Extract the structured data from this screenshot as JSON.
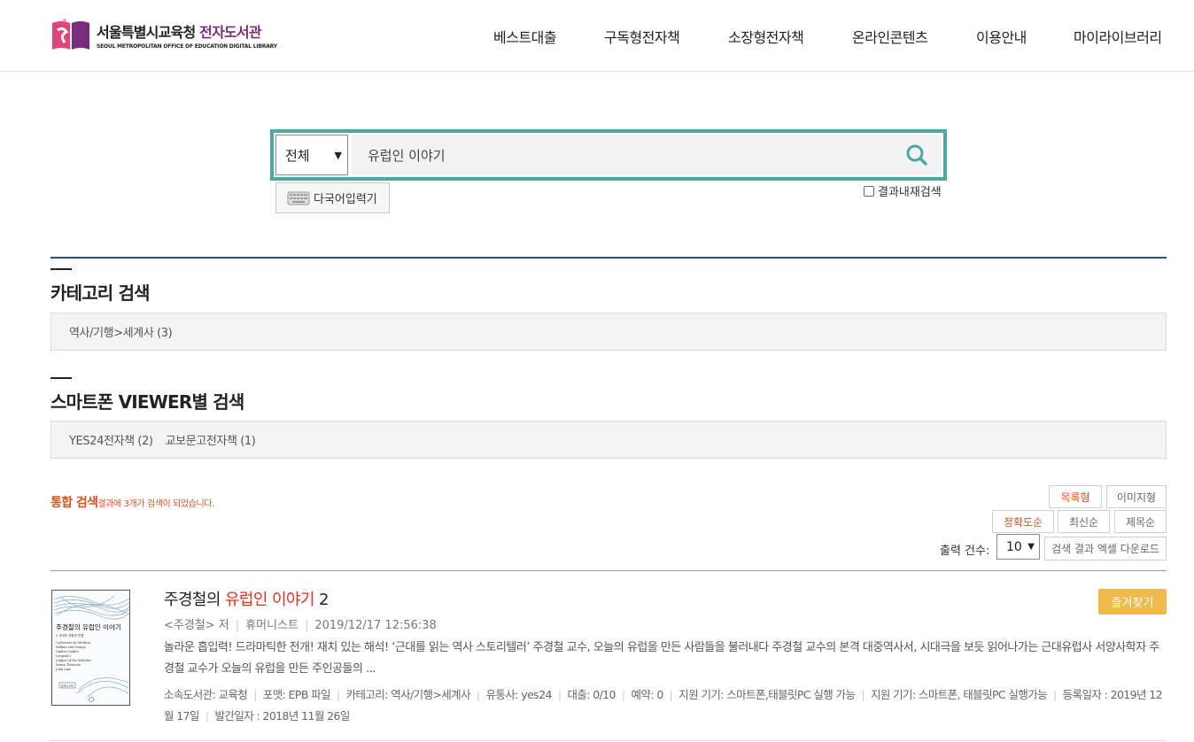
{
  "header": {
    "logo_title_main": "서울특별시교육청",
    "logo_title_accent": "전자도서관",
    "logo_subtitle": "SEOUL METROPOLITAN OFFICE OF EDUCATION DIGITAL LIBRARY",
    "nav": [
      "베스트대출",
      "구독형전자책",
      "소장형전자책",
      "온라인콘텐츠",
      "이용안내",
      "마이라이브러리"
    ]
  },
  "search": {
    "scope_selected": "전체",
    "query": "유럽인 이야기",
    "keyboard_label": "다국어입력기",
    "result_search_label": "결과내재검색",
    "accent_color": "#4aa9a3"
  },
  "sections": {
    "category_title": "카테고리 검색",
    "category_facets": [
      "역사/기행>세계사 (3)"
    ],
    "viewer_title": "스마트폰 VIEWER별 검색",
    "viewer_facets": [
      "YES24전자책 (2)",
      "교보문고전자책 (1)"
    ]
  },
  "results": {
    "summary_strong": "통합 검색",
    "summary_rest": "결과에 3개가 검색이 되었습니다.",
    "view_list": "목록형",
    "view_image": "이미지형",
    "sort_accuracy": "정확도순",
    "sort_latest": "최신순",
    "sort_title": "제목순",
    "count_label": "출력 건수:",
    "count_selected": "10",
    "excel_label": "검색 결과 엑셀 다운로드"
  },
  "items": [
    {
      "title_pre": "주경철의 ",
      "title_hl": "유럽인 이야기",
      "title_post": " 2",
      "author": "<주경철> 저",
      "publisher": "휴머니스트",
      "datetime": "2019/12/17 12:56:38",
      "description": "놀라운 흡입력! 드라마틱한 전개! 재치 있는 해석! ‘근대를 읽는 역사 스토리텔러’ 주경철 교수, 오늘의 유럽을 만든 사람들을 불러내다 주경철 교수의 본격 대중역사서, 시대극을 보듯 읽어나가는 근대유럽사 서양사학자 주경철 교수가 오늘의 유럽을 만든 주인공들의 ...",
      "info": [
        "소속도서관: 교육청",
        "포맷: EPB 파일",
        "카테고리: 역사/기행>세계사",
        "유통사: yes24",
        "대출: 0/10",
        "예약: 0",
        "지원 기기: 스마트폰,태블릿PC 실행 가능",
        "지원 기기: 스마트폰, 태블릿PC 실행가능",
        "등록일자 : 2019년 12월 17일",
        "발간일자 : 2018년 11월 26일"
      ],
      "fav_label": "즐겨찾기",
      "cover": {
        "title_line1": "주경철의 유럽인 이야기",
        "title_line2": "2 근대의 전환과 투쟁",
        "names": [
          "Catherine de Médicis",
          "Willem van Oranje",
          "Galileo Galilei",
          "Leopold I",
          "Judges of the Witches",
          "Maria Theresia",
          "John Law"
        ],
        "publisher": "휴머니스트"
      }
    }
  ]
}
